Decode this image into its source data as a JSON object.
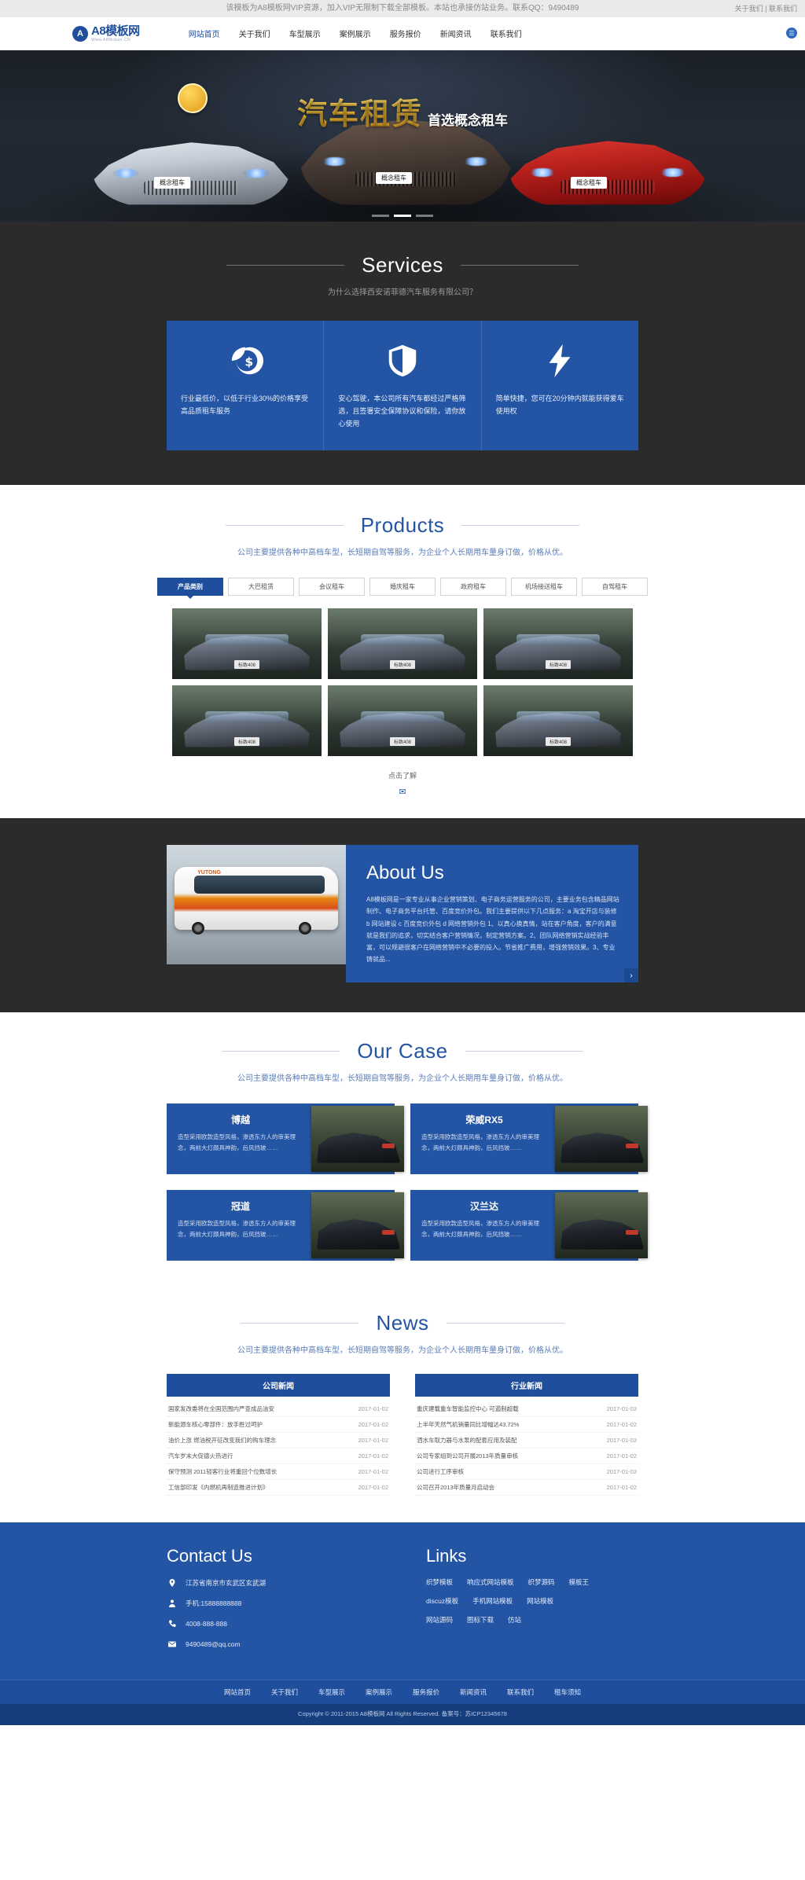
{
  "topbar": {
    "notice": "该模板为A8模板网VIP资源，加入VIP无限制下载全部模板。本站也承接仿站业务。联系QQ：9490489",
    "right": "关于我们 | 联系我们"
  },
  "header": {
    "logo_mark": "A",
    "logo_main": "A8模板网",
    "logo_sub": "Www.A8Moban.CN",
    "nav": [
      {
        "label": "网站首页"
      },
      {
        "label": "关于我们"
      },
      {
        "label": "车型展示"
      },
      {
        "label": "案例展示"
      },
      {
        "label": "服务报价"
      },
      {
        "label": "新闻资讯"
      },
      {
        "label": "联系我们"
      }
    ],
    "corner_icon": "☰"
  },
  "banner": {
    "title_main": "汽车租赁",
    "title_sub": "首选概念租车",
    "cars": [
      {
        "plate": "概念租车"
      },
      {
        "plate": "概念租车"
      },
      {
        "plate": "概念租车"
      }
    ]
  },
  "services": {
    "title": "Services",
    "subtitle": "为什么选择西安诺菲德汽车服务有限公司？",
    "cards": [
      {
        "icon": "dollar-coin-icon",
        "text": "行业最低价，以低于行业30%的价格享受高品质租车服务"
      },
      {
        "icon": "shield-icon",
        "text": "安心驾驶，本公司所有汽车都经过严格筛选，且签署安全保障协议和保险，请你放心使用"
      },
      {
        "icon": "lightning-icon",
        "text": "简单快捷，您可在20分钟内就能获得爱车使用权"
      }
    ]
  },
  "products": {
    "title": "Products",
    "subtitle": "公司主要提供各种中高档车型，长短期自驾等服务，为企业个人长期用车量身订做，价格从优。",
    "tabs": [
      {
        "label": "产品类别",
        "active": true
      },
      {
        "label": "大巴租赁",
        "active": false
      },
      {
        "label": "会议租车",
        "active": false
      },
      {
        "label": "婚庆租车",
        "active": false
      },
      {
        "label": "政府租车",
        "active": false
      },
      {
        "label": "机场接送租车",
        "active": false
      },
      {
        "label": "自驾租车",
        "active": false
      }
    ],
    "items": [
      {
        "plate": "标致408"
      },
      {
        "plate": "标致408"
      },
      {
        "plate": "标致408"
      },
      {
        "plate": "标致408"
      },
      {
        "plate": "标致408"
      },
      {
        "plate": "标致408"
      }
    ],
    "more_text": "点击了解",
    "more_arrow": "✉"
  },
  "about": {
    "title": "About Us",
    "image_label": "YUTONG",
    "text": "A8模板网是一家专业从事企业营销策划、电子商务运营服务的公司，主要业务包含精品网站制作、电子商务平台托管、百度竞价外包。我们主要提供以下几点服务：a 淘宝开店与装修 b 网站建设 c 百度竞价外包 d 网络营销外包 1、以真心换真情，站在客户角度，客户的满意就是我们的追求，切实结合客户营销情况，制定营销方案。2、团队网络营销实战经验丰富，可以规避很客户在网络营销中不必要的投入。节省推广费用，增强营销效果。3、专业铸就品...",
    "next_arrow": "›"
  },
  "case": {
    "title": "Our Case",
    "subtitle": "公司主要提供各种中高档车型，长短期自驾等服务，为企业个人长期用车量身订做，价格从优。",
    "items": [
      {
        "name": "博越",
        "desc": "造型采用欧款造型风格，渗透东方人的审美理念，两前大灯颇具神韵，后风挡玻……"
      },
      {
        "name": "荣威RX5",
        "desc": "造型采用欧款造型风格，渗透东方人的审美理念，两前大灯颇具神韵，后风挡玻……"
      },
      {
        "name": "冠道",
        "desc": "造型采用欧款造型风格，渗透东方人的审美理念，两前大灯颇具神韵，后风挡玻……"
      },
      {
        "name": "汉兰达",
        "desc": "造型采用欧款造型风格，渗透东方人的审美理念，两前大灯颇具神韵，后风挡玻……"
      }
    ]
  },
  "news": {
    "title": "News",
    "subtitle": "公司主要提供各种中高档车型，长短期自驾等服务，为企业个人长期用车量身订做，价格从优。",
    "columns": [
      {
        "heading": "公司新闻",
        "items": [
          {
            "title": "国家发改委将在全国范围内严查成品油安",
            "date": "2017-01-02"
          },
          {
            "title": "新能源车核心零部件：放手胜过呵护",
            "date": "2017-01-02"
          },
          {
            "title": "油价上涨 燃油税开征改变我们的购车理念",
            "date": "2017-01-02"
          },
          {
            "title": "汽车岁末大促德火热进行",
            "date": "2017-01-02"
          },
          {
            "title": "保守预测 2011轻客行业将重回个位数增长",
            "date": "2017-01-02"
          },
          {
            "title": "工信部印发《内燃机再制造推进计划》",
            "date": "2017-01-02"
          }
        ]
      },
      {
        "heading": "行业新闻",
        "items": [
          {
            "title": "重庆建载重车智能监控中心 可遏制超载",
            "date": "2017-01-02"
          },
          {
            "title": "上半年天然气机销量同比增幅达43.72%",
            "date": "2017-01-02"
          },
          {
            "title": "洒水车取力器与水泵的配套应用及装配",
            "date": "2017-01-02"
          },
          {
            "title": "公司专家组到公司开展2013年质量审核",
            "date": "2017-01-02"
          },
          {
            "title": "公司进行工序审核",
            "date": "2017-01-02"
          },
          {
            "title": "公司召开2013年质量月启动会",
            "date": "2017-01-02"
          }
        ]
      }
    ]
  },
  "footer": {
    "contact_title": "Contact Us",
    "contact": [
      {
        "icon": "location-pin-icon",
        "glyph": "📍",
        "text": "江苏省南京市玄武区玄武湖"
      },
      {
        "icon": "person-icon",
        "glyph": "👤",
        "text": "手机:15888888888"
      },
      {
        "icon": "telephone-icon",
        "glyph": "☎",
        "text": "4008-888-888"
      },
      {
        "icon": "envelope-icon",
        "glyph": "✉",
        "text": "9490489@qq.com"
      }
    ],
    "links_title": "Links",
    "links_rows": [
      [
        "织梦模板",
        "响应式网站模板",
        "织梦源码",
        "模板王"
      ],
      [
        "discuz模板",
        "手机网站模板",
        "网站模板"
      ],
      [
        "网站源码",
        "图标下载",
        "仿站"
      ]
    ],
    "bottom_nav": [
      "网站首页",
      "关于我们",
      "车型展示",
      "案例展示",
      "服务报价",
      "新闻资讯",
      "联系我们",
      "租车须知"
    ],
    "copyright": "Copyright © 2011-2015 A8模板网 All Rights Reserved.   备案号：苏ICP12345678"
  },
  "colors": {
    "brand_blue": "#2455a4",
    "deep_blue": "#1f4e9c",
    "dark_bg": "#2b2b2b",
    "gold": "#f5c13a"
  }
}
